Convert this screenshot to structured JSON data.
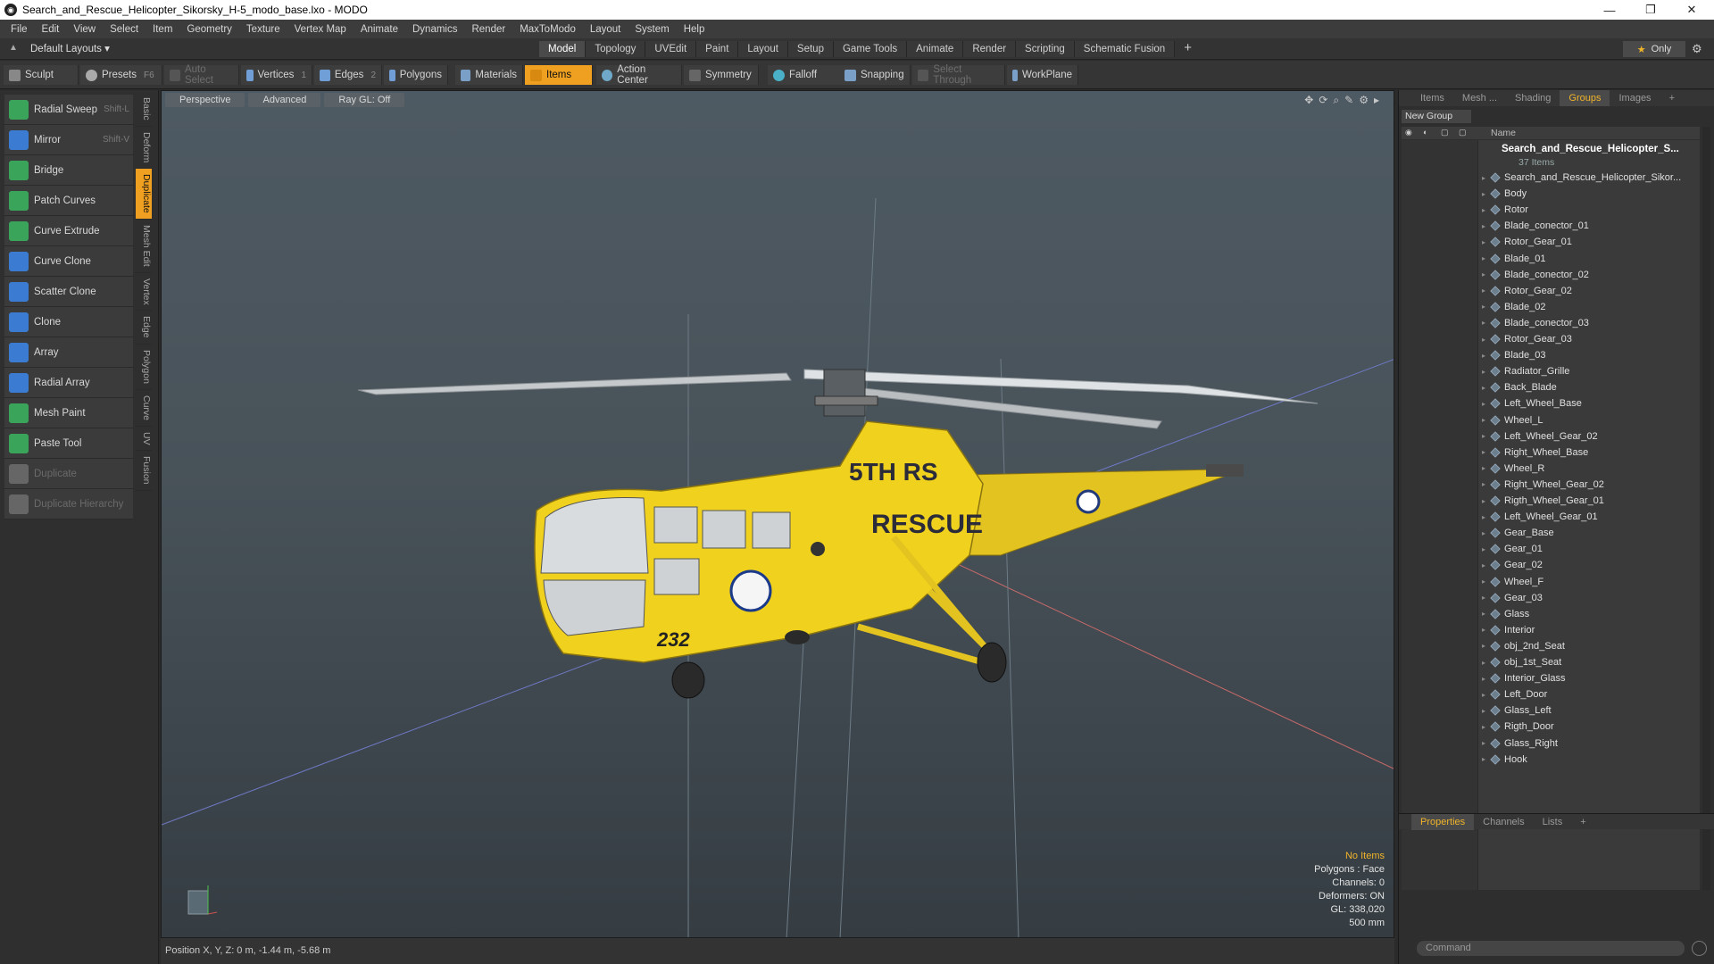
{
  "window": {
    "title": "Search_and_Rescue_Helicopter_Sikorsky_H-5_modo_base.lxo - MODO",
    "controls": [
      "—",
      "❐",
      "✕"
    ]
  },
  "menu": [
    "File",
    "Edit",
    "View",
    "Select",
    "Item",
    "Geometry",
    "Texture",
    "Vertex Map",
    "Animate",
    "Dynamics",
    "Render",
    "MaxToModo",
    "Layout",
    "System",
    "Help"
  ],
  "layout_selector": "Default Layouts ▾",
  "layout_tabs": [
    "Model",
    "Topology",
    "UVEdit",
    "Paint",
    "Layout",
    "Setup",
    "Game Tools",
    "Animate",
    "Render",
    "Scripting",
    "Schematic Fusion"
  ],
  "active_layout_tab": "Model",
  "only_label": "Only",
  "toolbar": {
    "sculpt": "Sculpt",
    "presets": "Presets",
    "presets_key": "F6",
    "auto_select": "Auto Select",
    "vertices": "Vertices",
    "vertices_n": "1",
    "edges": "Edges",
    "edges_n": "2",
    "polygons": "Polygons",
    "materials": "Materials",
    "items": "Items",
    "action_center": "Action Center",
    "symmetry": "Symmetry",
    "falloff": "Falloff",
    "snapping": "Snapping",
    "select_through": "Select Through",
    "workplane": "WorkPlane"
  },
  "tools": [
    {
      "label": "Radial Sweep",
      "shortcut": "Shift-L",
      "color": "#3aa55a"
    },
    {
      "label": "Mirror",
      "shortcut": "Shift-V",
      "color": "#3b7bd1"
    },
    {
      "label": "Bridge",
      "shortcut": "",
      "color": "#3aa55a"
    },
    {
      "label": "Patch Curves",
      "shortcut": "",
      "color": "#3aa55a"
    },
    {
      "label": "Curve Extrude",
      "shortcut": "",
      "color": "#3aa55a"
    },
    {
      "label": "Curve Clone",
      "shortcut": "",
      "color": "#3b7bd1"
    },
    {
      "label": "Scatter Clone",
      "shortcut": "",
      "color": "#3b7bd1"
    },
    {
      "label": "Clone",
      "shortcut": "",
      "color": "#3b7bd1"
    },
    {
      "label": "Array",
      "shortcut": "",
      "color": "#3b7bd1"
    },
    {
      "label": "Radial Array",
      "shortcut": "",
      "color": "#3b7bd1"
    },
    {
      "label": "Mesh Paint",
      "shortcut": "",
      "color": "#3aa55a"
    },
    {
      "label": "Paste Tool",
      "shortcut": "",
      "color": "#3aa55a"
    },
    {
      "label": "Duplicate",
      "shortcut": "",
      "color": "#666666"
    },
    {
      "label": "Duplicate Hierarchy",
      "shortcut": "",
      "color": "#666666"
    }
  ],
  "side_tabs": [
    "Basic",
    "Deform",
    "Duplicate",
    "Mesh Edit",
    "Vertex",
    "Edge",
    "Polygon",
    "Curve",
    "UV",
    "Fusion"
  ],
  "active_side_tab": "Duplicate",
  "viewport": {
    "buttons": [
      "Perspective",
      "Advanced",
      "Ray GL: Off"
    ],
    "stats": {
      "no_items": "No Items",
      "polygons": "Polygons : Face",
      "channels": "Channels: 0",
      "deformers": "Deformers: ON",
      "gl": "GL: 338,020",
      "scale": "500 mm"
    },
    "marking": {
      "unit": "5TH RS",
      "rescue": "RESCUE",
      "number": "232"
    }
  },
  "status": "Position X, Y, Z:   0 m, -1.44 m, -5.68 m",
  "right_tabs": [
    "Items",
    "Mesh ...",
    "Shading",
    "Groups",
    "Images"
  ],
  "active_right_tab": "Groups",
  "new_group": "New Group",
  "name_header": "Name",
  "group_root": "Search_and_Rescue_Helicopter_S...",
  "group_count": "37 Items",
  "group_items": [
    "Search_and_Rescue_Helicopter_Sikor...",
    "Body",
    "Rotor",
    "Blade_conector_01",
    "Rotor_Gear_01",
    "Blade_01",
    "Blade_conector_02",
    "Rotor_Gear_02",
    "Blade_02",
    "Blade_conector_03",
    "Rotor_Gear_03",
    "Blade_03",
    "Radiator_Grille",
    "Back_Blade",
    "Left_Wheel_Base",
    "Wheel_L",
    "Left_Wheel_Gear_02",
    "Right_Wheel_Base",
    "Wheel_R",
    "Right_Wheel_Gear_02",
    "Rigth_Wheel_Gear_01",
    "Left_Wheel_Gear_01",
    "Gear_Base",
    "Gear_01",
    "Gear_02",
    "Wheel_F",
    "Gear_03",
    "Glass",
    "Interior",
    "obj_2nd_Seat",
    "obj_1st_Seat",
    "Interior_Glass",
    "Left_Door",
    "Glass_Left",
    "Rigth_Door",
    "Glass_Right",
    "Hook"
  ],
  "bottom_tabs": [
    "Properties",
    "Channels",
    "Lists"
  ],
  "active_bottom_tab": "Properties",
  "command_placeholder": "Command"
}
